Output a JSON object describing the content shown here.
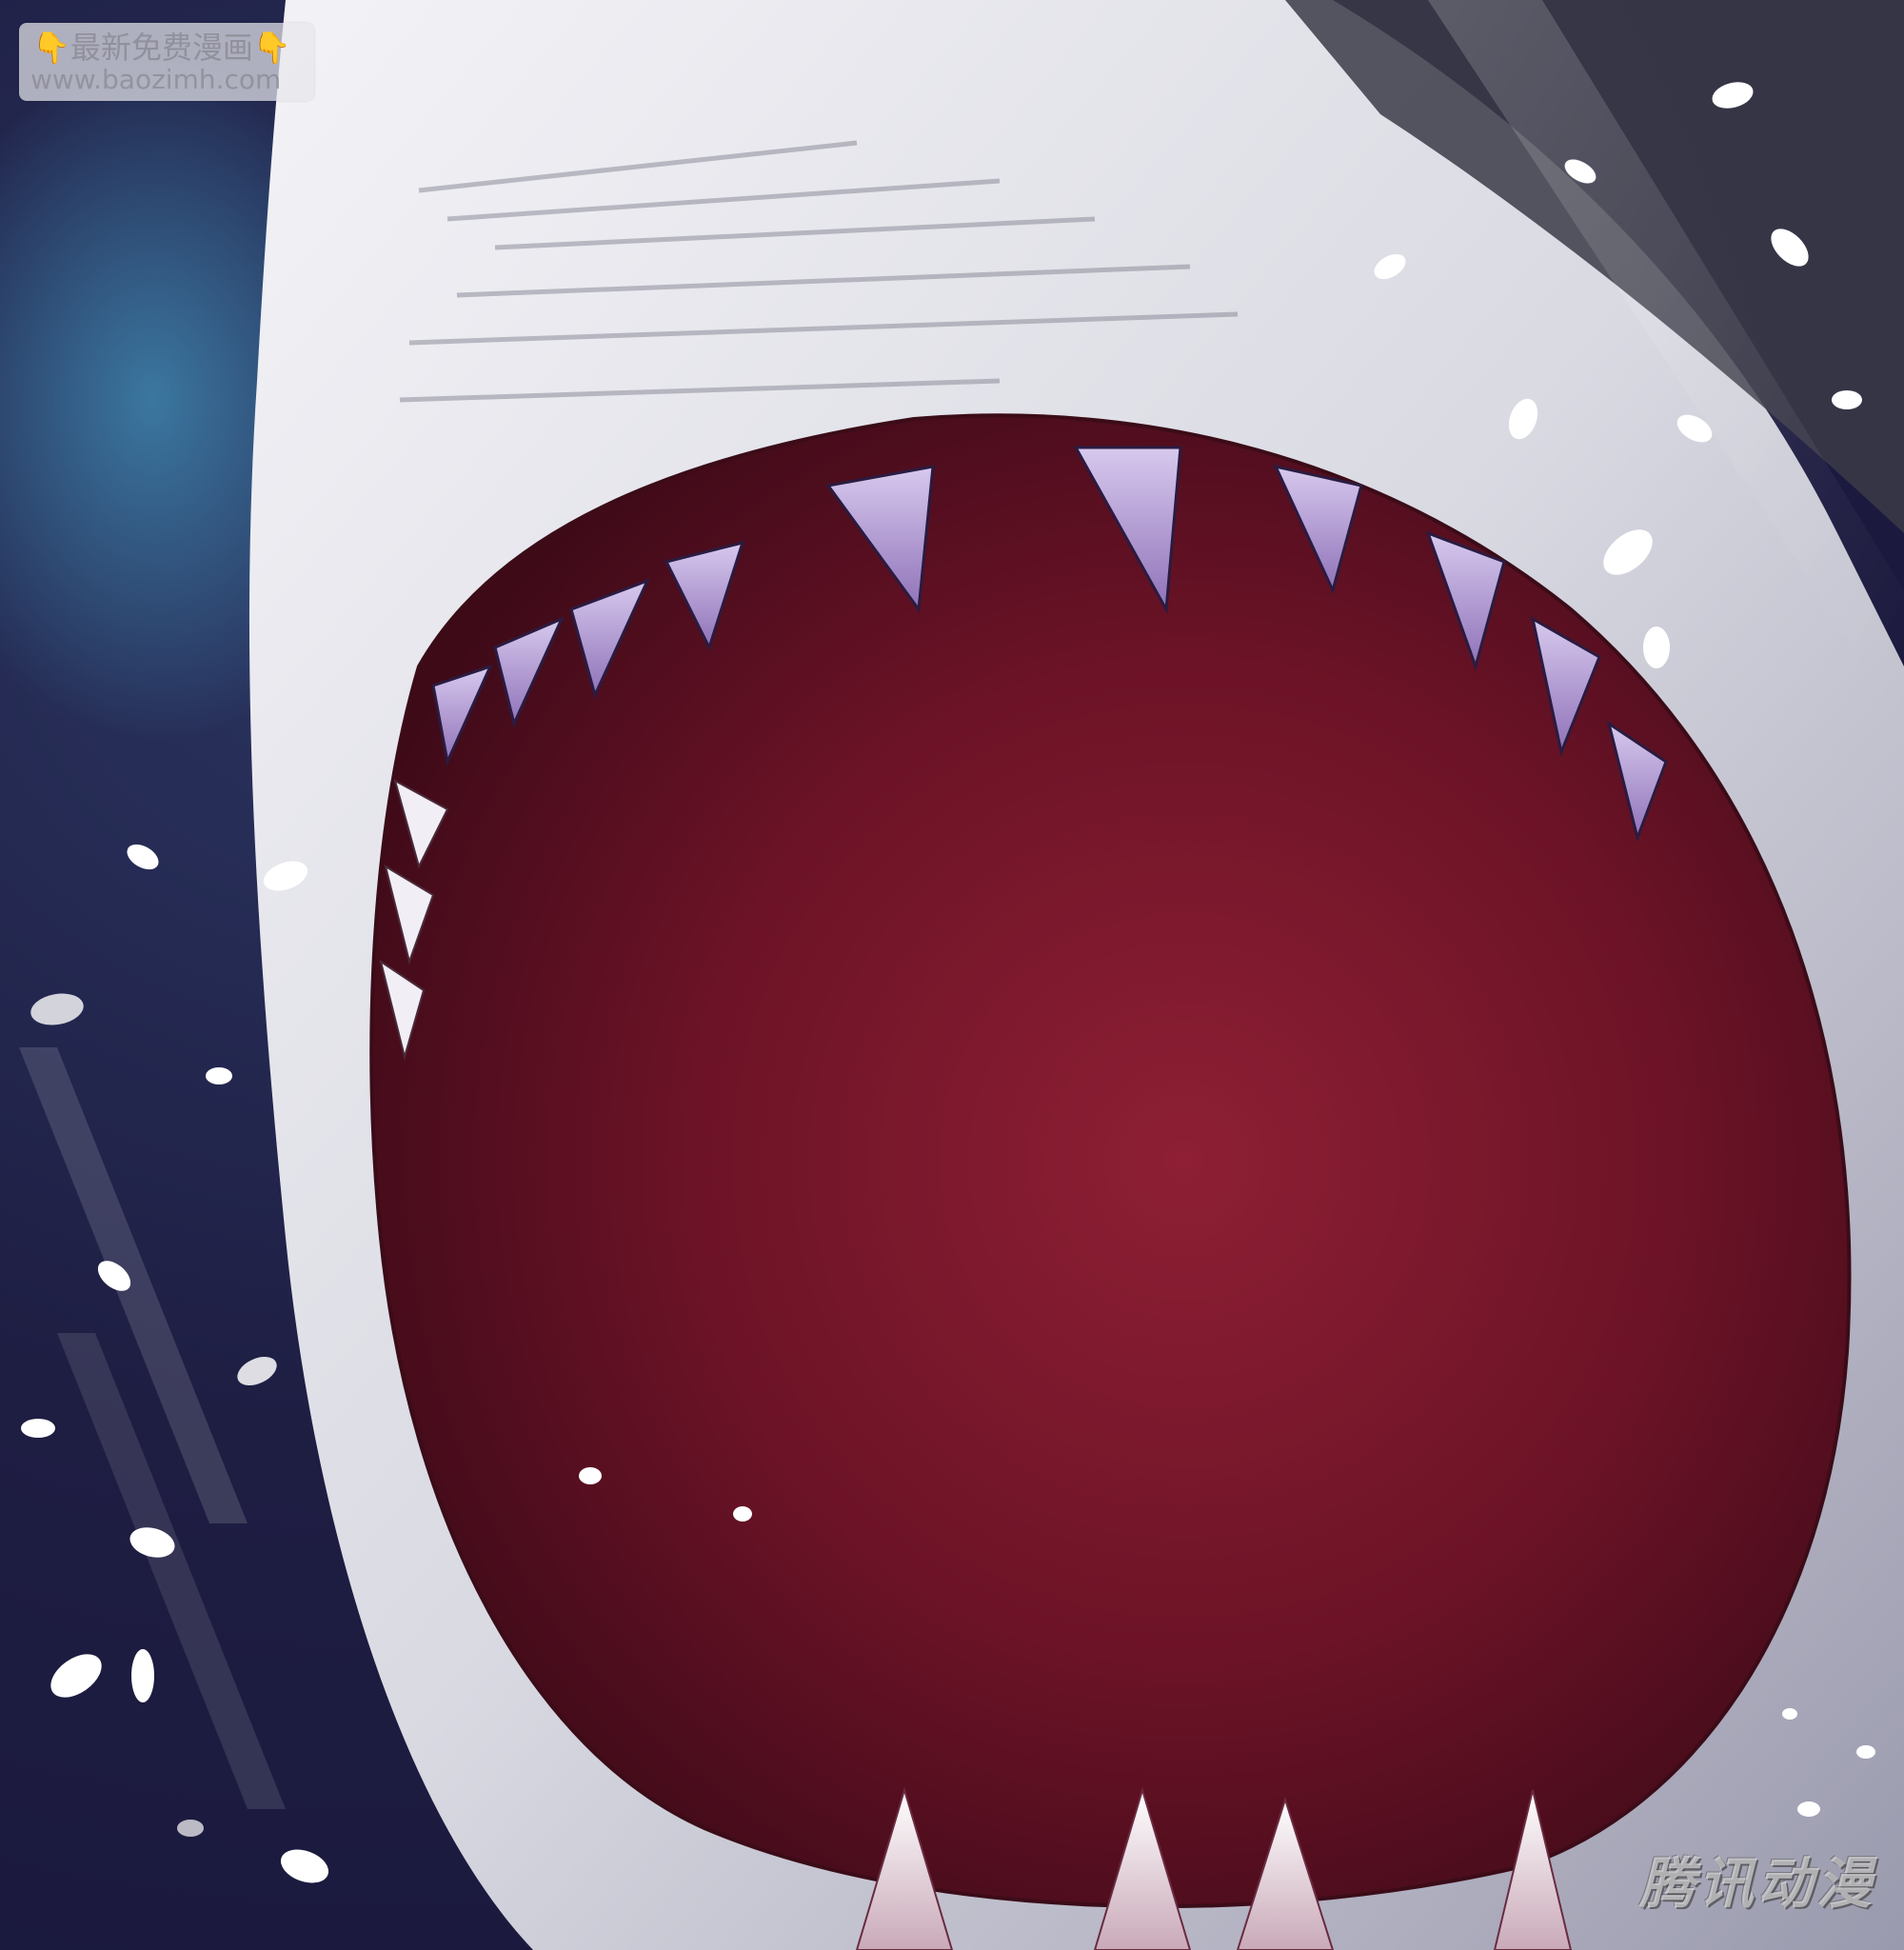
{
  "scene": {
    "subject_icon": "shark-jaws-illustration",
    "colors": {
      "background": "#1e1d42",
      "mouth": "#7a1a2c",
      "skin": "#e4e4ec",
      "teeth": "#b7a0d6",
      "splash": "#ffffff"
    }
  },
  "watermark_top": {
    "hand_left": "👇",
    "text": "最新免费漫画",
    "hand_right": "👇",
    "url": "www.baozimh.com"
  },
  "watermark_bottom": {
    "text": "腾讯动漫"
  }
}
